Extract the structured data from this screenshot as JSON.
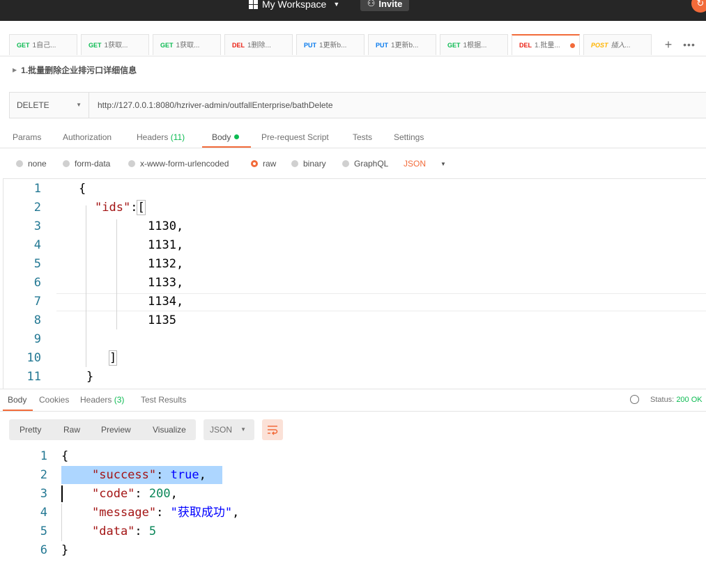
{
  "topbar": {
    "workspace": "My Workspace",
    "invite": "Invite",
    "workspace_icon": "grid-icon",
    "invite_icon": "add-user-icon",
    "sync_icon": "sync-icon"
  },
  "tabs": [
    {
      "method": "GET",
      "title": "1自己..."
    },
    {
      "method": "GET",
      "title": "1获取..."
    },
    {
      "method": "GET",
      "title": "1获取..."
    },
    {
      "method": "DEL",
      "title": "1删除..."
    },
    {
      "method": "PUT",
      "title": "1更新b..."
    },
    {
      "method": "PUT",
      "title": "1更新b..."
    },
    {
      "method": "GET",
      "title": "1根据..."
    },
    {
      "method": "DEL",
      "title": "1.批量...",
      "active": true
    },
    {
      "method": "POST",
      "title": "插入..."
    }
  ],
  "request": {
    "name": "1.批量删除企业排污口详细信息",
    "method": "DELETE",
    "url": "http://127.0.0.1:8080/hzriver-admin/outfallEnterprise/bathDelete"
  },
  "request_tabs": {
    "params": "Params",
    "authorization": "Authorization",
    "headers": "Headers",
    "headers_count": "(11)",
    "body": "Body",
    "prerequest": "Pre-request Script",
    "tests": "Tests",
    "settings": "Settings"
  },
  "body_options": {
    "none": "none",
    "form_data": "form-data",
    "urlencoded": "x-www-form-urlencoded",
    "raw": "raw",
    "binary": "binary",
    "graphql": "GraphQL",
    "format": "JSON",
    "selected": "raw"
  },
  "editor": {
    "line_numbers": [
      "1",
      "2",
      "3",
      "4",
      "5",
      "6",
      "7",
      "8",
      "9",
      "10",
      "11"
    ],
    "key": "\"ids\"",
    "ids": [
      "1130,",
      "1131,",
      "1132,",
      "1133,",
      "1134,",
      "1135"
    ]
  },
  "response_tabs": {
    "body": "Body",
    "cookies": "Cookies",
    "headers": "Headers",
    "headers_count": "(3)",
    "test_results": "Test Results",
    "status_label": "Status:",
    "status_value": "200 OK"
  },
  "response_view": {
    "pretty": "Pretty",
    "raw": "Raw",
    "preview": "Preview",
    "visualize": "Visualize",
    "format": "JSON"
  },
  "response": {
    "line_numbers": [
      "1",
      "2",
      "3",
      "4",
      "5",
      "6"
    ],
    "success_key": "\"success\"",
    "success_val": "true",
    "code_key": "\"code\"",
    "code_val": "200",
    "message_key": "\"message\"",
    "message_val": "\"获取成功\"",
    "data_key": "\"data\"",
    "data_val": "5"
  },
  "colors": {
    "accent": "#f26b3a",
    "get": "#0cbb52",
    "delete": "#eb2013",
    "put": "#097bed",
    "post": "#ffb400"
  }
}
